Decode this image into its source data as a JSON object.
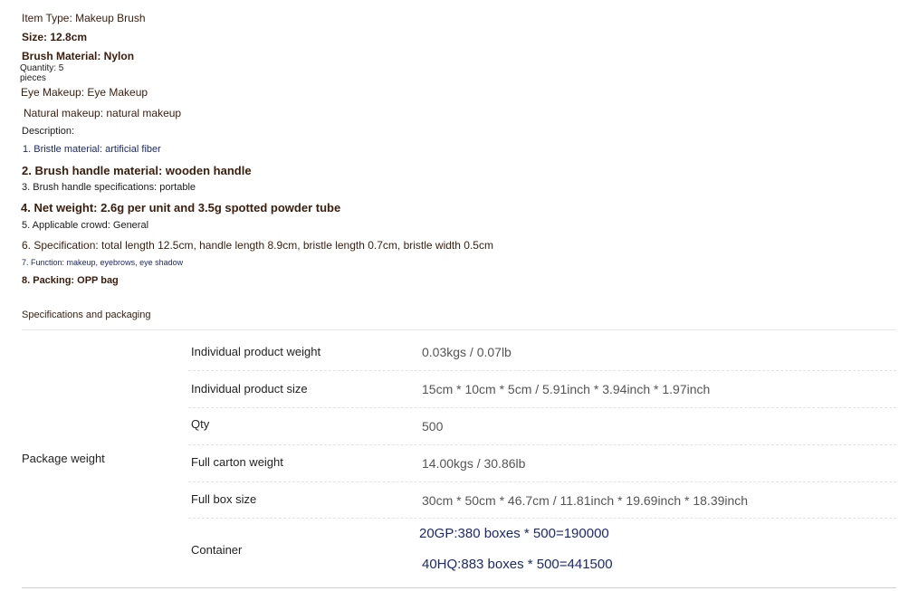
{
  "attributes": [
    {
      "text": "Item Type: Makeup Brush"
    },
    {
      "text": "Size: 12.8cm"
    },
    {
      "text": "Brush Material: Nylon"
    },
    {
      "text": "Quantity: 5"
    },
    {
      "text": "pieces"
    },
    {
      "text": "Eye Makeup: Eye Makeup"
    },
    {
      "text": "Natural makeup: natural makeup"
    }
  ],
  "description": {
    "label": "Description:",
    "items": [
      "1. Bristle material: artificial fiber",
      "2. Brush handle material: wooden handle",
      "3. Brush handle specifications: portable",
      "4. Net weight: 2.6g per unit and 3.5g spotted powder tube",
      "5. Applicable crowd: General",
      "6. Specification: total length 12.5cm, handle length 8.9cm, bristle length 0.7cm, bristle width 0.5cm",
      "7. Function: makeup, eyebrows, eye shadow",
      "8. Packing: OPP bag"
    ]
  },
  "packaging": {
    "title": "Specifications and packaging",
    "group_label": "Package weight",
    "rows": [
      {
        "label": "Individual product weight",
        "value": "0.03kgs / 0.07lb"
      },
      {
        "label": "Individual product size",
        "value": "15cm * 10cm * 5cm / 5.91inch * 3.94inch * 1.97inch"
      },
      {
        "label": "Qty",
        "value": "500"
      },
      {
        "label": "Full carton weight",
        "value": "14.00kgs / 30.86lb"
      },
      {
        "label": "Full box size",
        "value": "30cm * 50cm * 46.7cm / 11.81inch * 19.69inch * 18.39inch"
      }
    ],
    "container": {
      "label": "Container",
      "values": [
        "20GP:380 boxes * 500=190000",
        "40HQ:883 boxes * 500=441500"
      ]
    }
  }
}
